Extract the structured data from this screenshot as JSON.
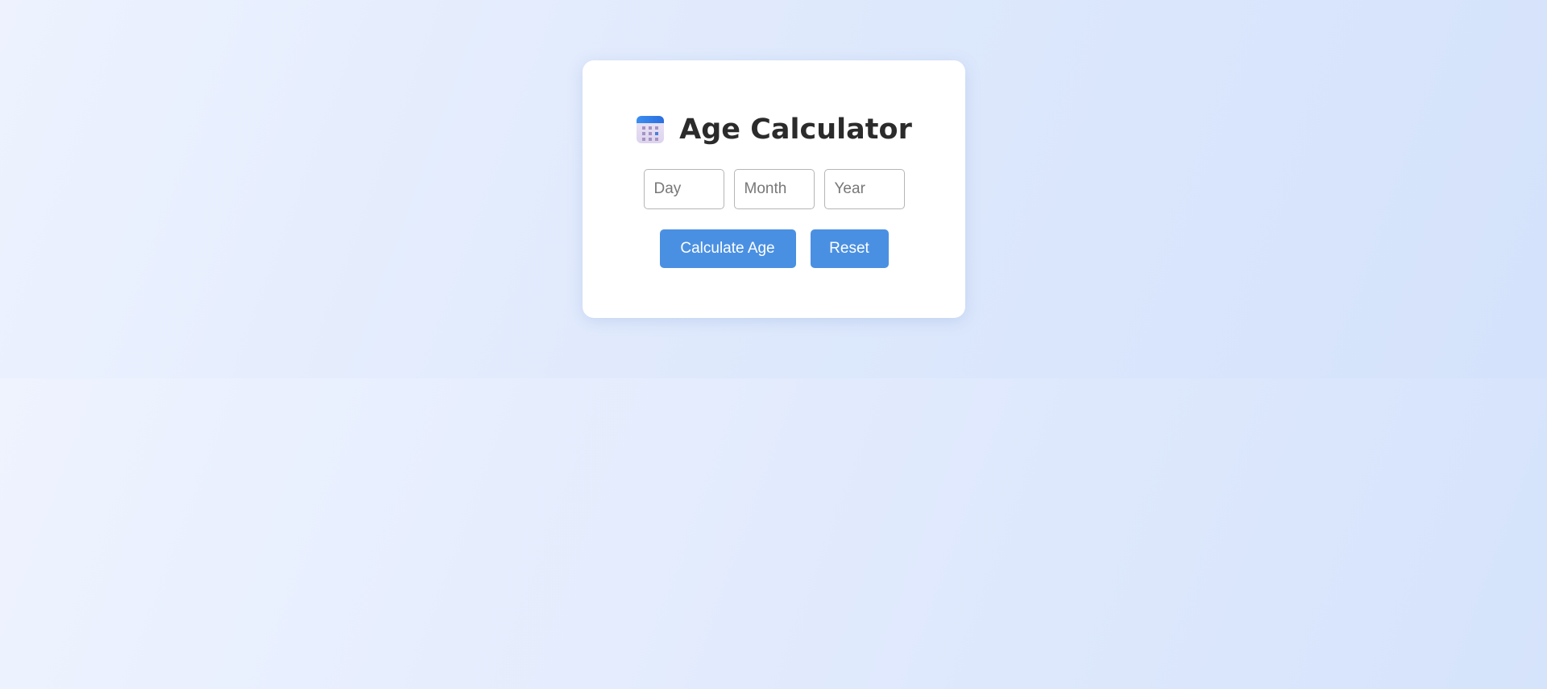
{
  "app": {
    "title": "Age Calculator",
    "title_icon": "calendar-icon"
  },
  "form": {
    "day_placeholder": "Day",
    "month_placeholder": "Month",
    "year_placeholder": "Year",
    "day_value": "",
    "month_value": "",
    "year_value": ""
  },
  "actions": {
    "calculate_label": "Calculate Age",
    "reset_label": "Reset"
  },
  "colors": {
    "accent": "#4a90e2",
    "title_text": "#2b2b2b",
    "card_background": "#ffffff"
  }
}
